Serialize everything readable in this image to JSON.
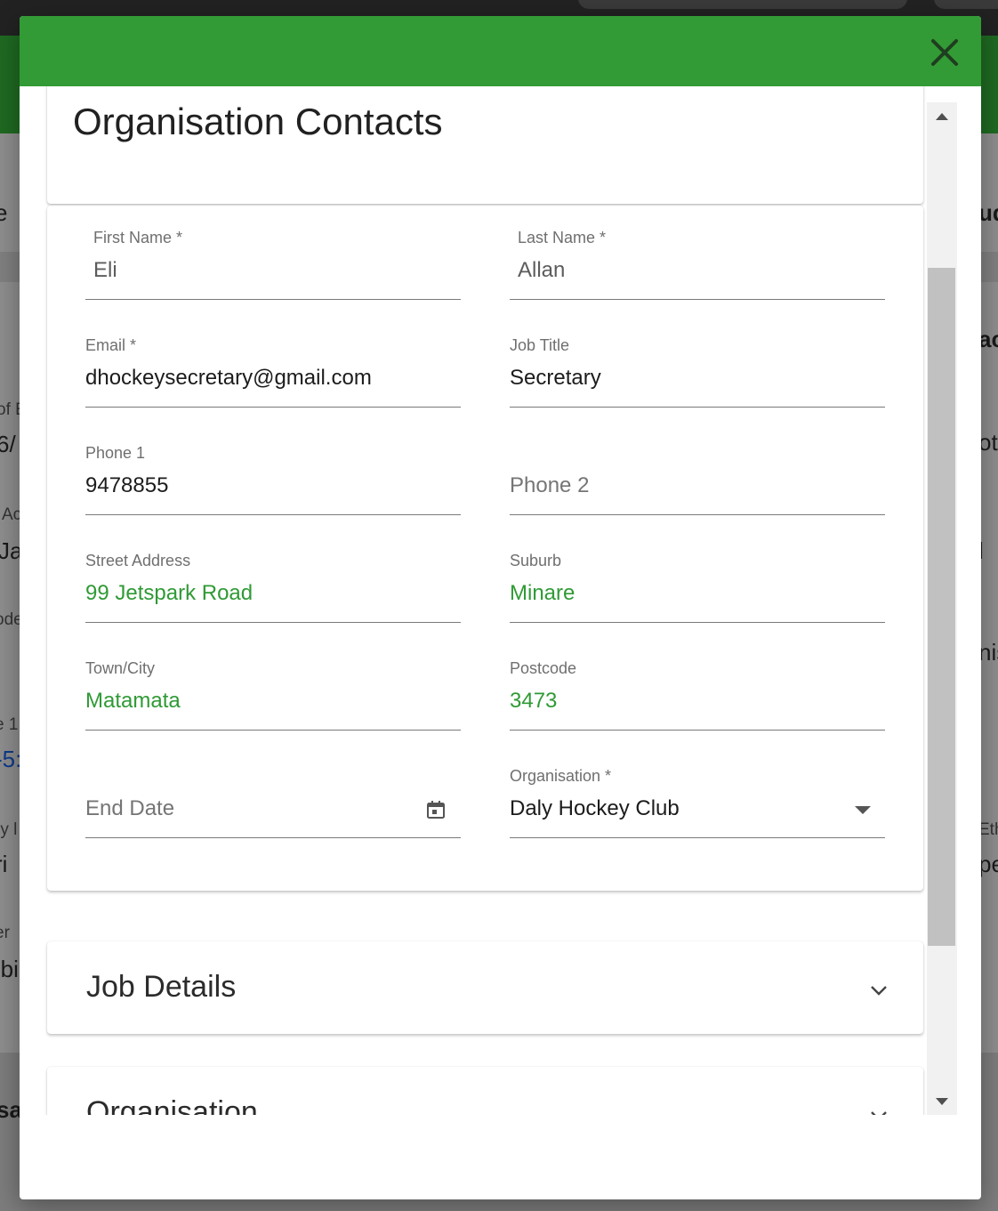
{
  "background": {
    "fragments_left": [
      "e",
      "of E",
      "6/",
      "Ac",
      "Ja",
      "ode",
      ")",
      "e 1",
      "-5:",
      "ry l",
      "ri",
      "er",
      "-bi",
      "sa"
    ],
    "fragments_right": [
      "ud",
      "ac",
      "ot",
      "l",
      "nis",
      "Eth",
      "pe"
    ]
  },
  "modal": {
    "title": "Organisation Contacts",
    "close_icon": "close-icon",
    "fields": {
      "first_name": {
        "label": "First Name *",
        "value": "Eli"
      },
      "last_name": {
        "label": "Last Name *",
        "value": "Allan"
      },
      "email": {
        "label": "Email *",
        "value": "dhockeysecretary@gmail.com"
      },
      "job_title": {
        "label": "Job Title",
        "value": "Secretary"
      },
      "phone1": {
        "label": "Phone 1",
        "value": "9478855"
      },
      "phone2": {
        "placeholder": "Phone 2"
      },
      "street_address": {
        "label": "Street Address",
        "value": "99 Jetspark Road"
      },
      "suburb": {
        "label": "Suburb",
        "value": "Minare"
      },
      "town_city": {
        "label": "Town/City",
        "value": "Matamata"
      },
      "postcode": {
        "label": "Postcode",
        "value": "3473"
      },
      "end_date": {
        "placeholder": "End Date",
        "icon": "calendar-icon"
      },
      "organisation": {
        "label": "Organisation *",
        "value": "Daly Hockey Club",
        "icon": "dropdown-arrow-icon"
      }
    },
    "sections": [
      {
        "title": "Job Details",
        "icon": "chevron-down-icon"
      },
      {
        "title": "Organisation",
        "icon": "chevron-down-icon"
      }
    ]
  },
  "colors": {
    "header_green": "#339b35",
    "value_green": "#2f9a35"
  }
}
